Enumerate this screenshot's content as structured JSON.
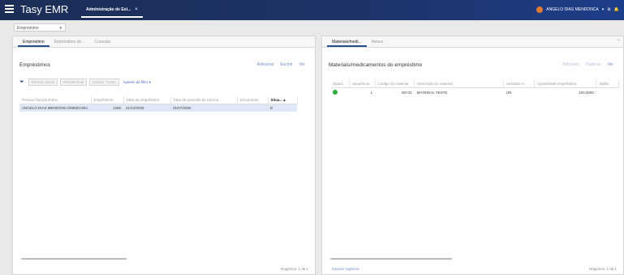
{
  "app": {
    "brand": "Tasy EMR",
    "tab_label": "Administração de Est...",
    "tab_close": "×"
  },
  "user": {
    "name": "ANGELO DIAS MENDONCA",
    "menu_caret": "▾",
    "settings_icon": "⚙",
    "bell_icon": "🔔"
  },
  "selector": {
    "value": "Empréstimo",
    "caret": "▾"
  },
  "left": {
    "tabs": [
      "Empréstimo",
      "Empréstimo de...",
      "Consulta"
    ],
    "title": "Empréstimos",
    "actions": [
      "Adicionar",
      "Excluir",
      "Ver"
    ],
    "filters": [
      "Período inicial",
      "Período final",
      "Estado: Todos"
    ],
    "filter_link": "Ajustes de filtro ▾",
    "columns": [
      "Pessoa física/Jurídica",
      "Empréstimo",
      "Data do empréstimo",
      "Data de previsão de retorno",
      "Documento",
      "Situa.. ▲"
    ],
    "rows": [
      {
        "pessoa": "ANGELO DIAS MENDONCA/MEDICINA",
        "emprestimo": "1280",
        "data": "21/12/2025",
        "previsao": "31/07/2026",
        "documento": "",
        "situacao": "D"
      }
    ],
    "footer": "Registros: 1 de 1"
  },
  "right": {
    "tabs": [
      "Materiais/medi...",
      "Avisos"
    ],
    "title": "Materiais/medicamentos do empréstimo",
    "actions": [
      "Adicionar",
      "Duplicar",
      "Ver"
    ],
    "columns": [
      "Status",
      "Sequência",
      "Código do material",
      "Descrição do material",
      "Unidade m...",
      "Quantidade empréstimo",
      "Saldo"
    ],
    "rows": [
      {
        "sequencia": "1",
        "codigo": "80742",
        "descricao": "MATERIAL TESTE",
        "unidade": "UN",
        "quantidade": "100,0000",
        "saldo": ""
      }
    ],
    "footer_link": "Mostrar registros",
    "footer": "Registros: 1 de 1"
  }
}
